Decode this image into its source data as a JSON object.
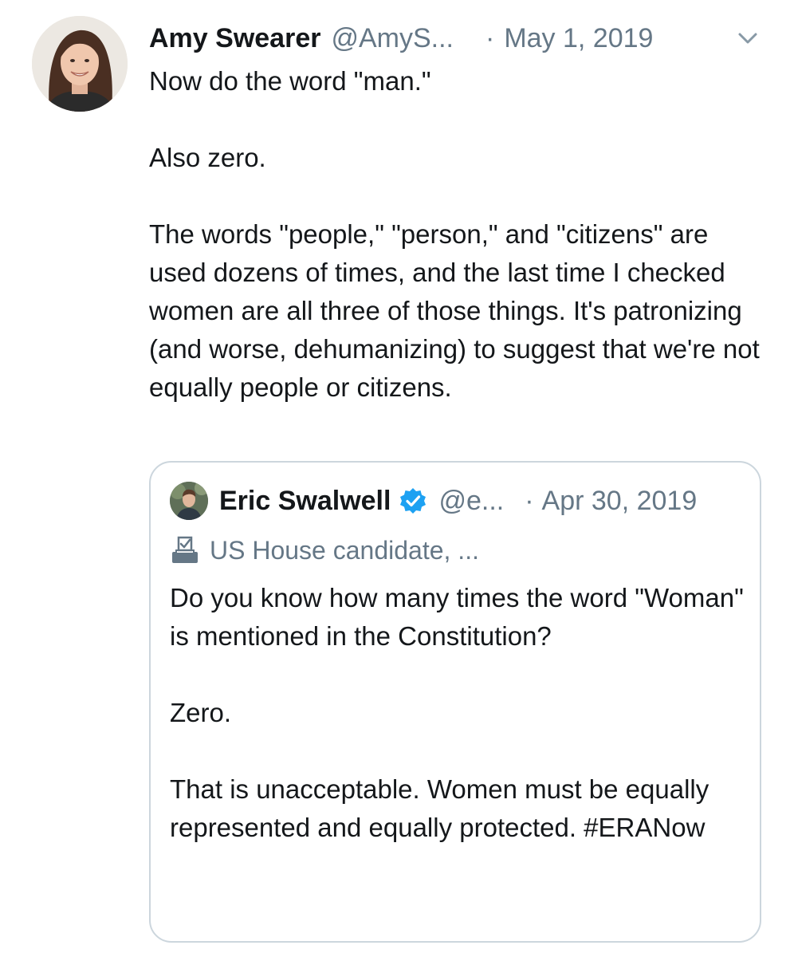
{
  "tweet": {
    "author_name": "Amy Swearer",
    "author_handle": "@AmyS...",
    "separator": "·",
    "date": "May 1, 2019",
    "paragraphs": [
      "Now do the word \"man.\"",
      "Also zero.",
      "The words \"people,\" \"person,\" and \"citizens\" are used dozens of times, and the last time I checked women are all three of those things. It's patronizing (and worse, dehumanizing) to suggest that we're not equally people or citizens."
    ],
    "menu_icon": "chevron-down-icon"
  },
  "quoted_tweet": {
    "author_name": "Eric Swalwell",
    "verified_icon": "verified-badge-icon",
    "author_handle": "@e...",
    "separator": "·",
    "date": "Apr 30, 2019",
    "label_icon": "ballot-box-icon",
    "label": "US House candidate, ...",
    "paragraphs": [
      "Do you know how many times the word \"Woman\" is mentioned in the Constitution?",
      "Zero.",
      "That is unacceptable. Women must be equally represented and equally protected. #ERANow"
    ]
  },
  "colors": {
    "text": "#14171a",
    "secondary_text": "#657786",
    "border": "#ccd6dd",
    "verified": "#1da1f2"
  }
}
